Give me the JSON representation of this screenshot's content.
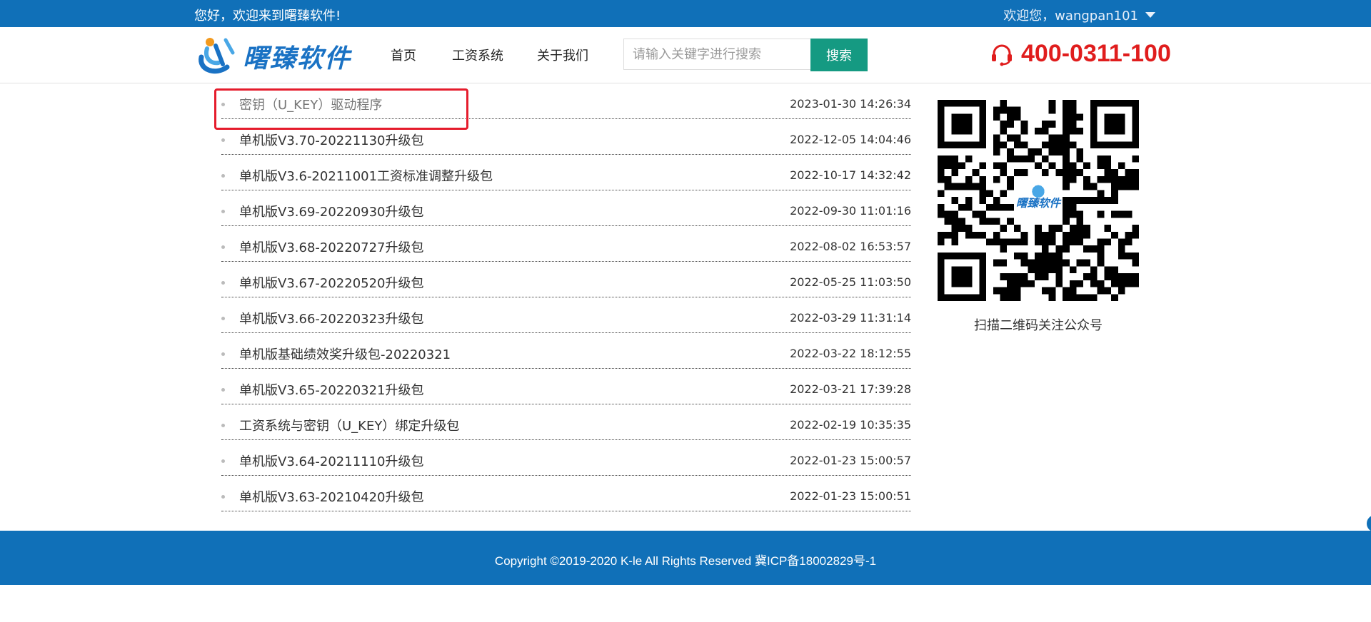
{
  "topbar": {
    "greeting": "您好，欢迎来到曙臻软件!",
    "user": "欢迎您，wangpan101"
  },
  "header": {
    "logo_text": "曙臻软件",
    "nav": [
      "首页",
      "工资系统",
      "关于我们"
    ],
    "search_placeholder": "请输入关键字进行搜索",
    "search_button": "搜索",
    "phone": "400-0311-100"
  },
  "downloads": [
    {
      "title": "密钥（U_KEY）驱动程序",
      "date": "2023-01-30 14:26:34"
    },
    {
      "title": "单机版V3.70-20221130升级包",
      "date": "2022-12-05 14:04:46"
    },
    {
      "title": "单机版V3.6-20211001工资标准调整升级包",
      "date": "2022-10-17 14:32:42"
    },
    {
      "title": "单机版V3.69-20220930升级包",
      "date": "2022-09-30 11:01:16"
    },
    {
      "title": "单机版V3.68-20220727升级包",
      "date": "2022-08-02 16:53:57"
    },
    {
      "title": "单机版V3.67-20220520升级包",
      "date": "2022-05-25 11:03:50"
    },
    {
      "title": "单机版V3.66-20220323升级包",
      "date": "2022-03-29 11:31:14"
    },
    {
      "title": "单机版基础绩效奖升级包-20220321",
      "date": "2022-03-22 18:12:55"
    },
    {
      "title": "单机版V3.65-20220321升级包",
      "date": "2022-03-21 17:39:28"
    },
    {
      "title": "工资系统与密钥（U_KEY）绑定升级包",
      "date": "2022-02-19 10:35:35"
    },
    {
      "title": "单机版V3.64-20211110升级包",
      "date": "2022-01-23 15:00:57"
    },
    {
      "title": "单机版V3.63-20210420升级包",
      "date": "2022-01-23 15:00:51"
    }
  ],
  "qr": {
    "caption": "扫描二维码关注公众号",
    "center_logo": "曙臻软件"
  },
  "footer": {
    "copyright": "Copyright ©2019-2020 K-le All Rights Reserved  冀ICP备18002829号-1"
  },
  "colors": {
    "brand_blue": "#1070b8",
    "search_green": "#159a82",
    "phone_red": "#e01d1d",
    "highlight_red": "#e51c2c"
  }
}
